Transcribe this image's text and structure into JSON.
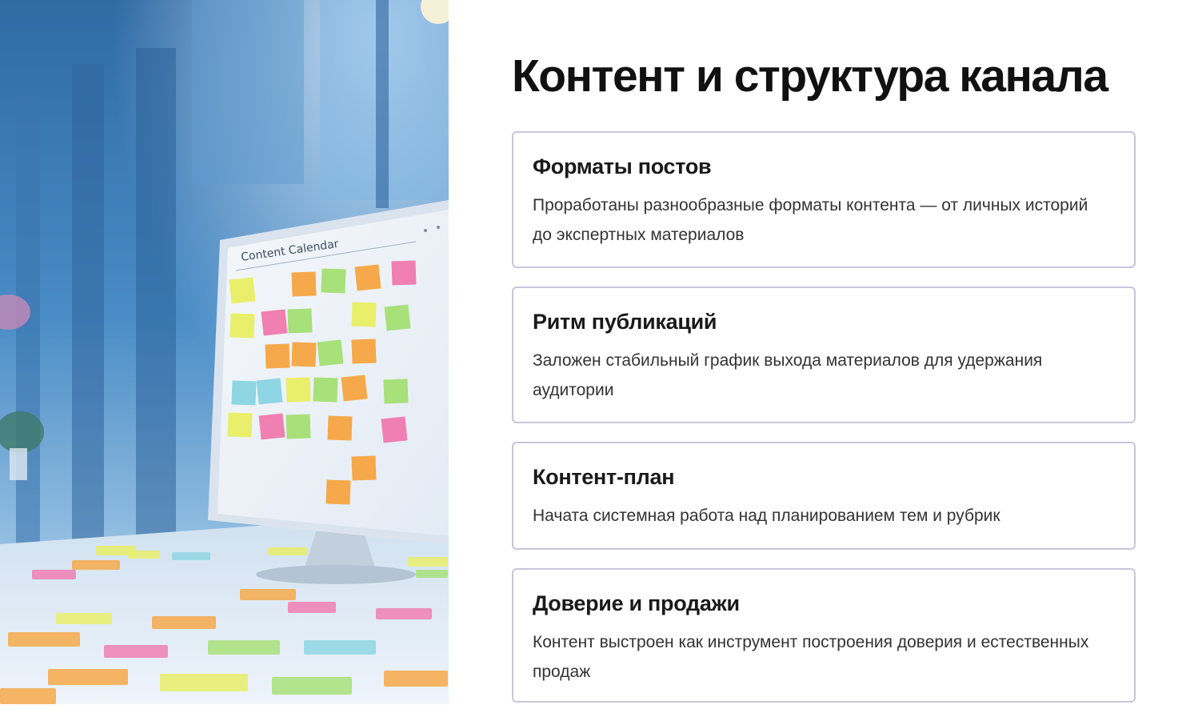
{
  "page": {
    "title": "Контент и структура канала"
  },
  "illustration": {
    "icon": "content-calendar-monitor-illustration",
    "monitor_label": "Content Calendar"
  },
  "cards": [
    {
      "title": "Форматы постов",
      "text": "Проработаны разнообразные форматы контента — от личных историй до экспертных материалов"
    },
    {
      "title": "Ритм публикаций",
      "text": "Заложен стабильный график выхода материалов для удержания аудитории"
    },
    {
      "title": "Контент-план",
      "text": "Начата системная работа над планированием тем и рубрик"
    },
    {
      "title": "Доверие и продажи",
      "text": "Контент выстроен как инструмент построения доверия и естественных продаж"
    }
  ],
  "colors": {
    "title": "#111111",
    "card_border": "#c9c6d9",
    "card_text": "#333333",
    "sticky_yellow": "#e9ef6a",
    "sticky_orange": "#f6a94a",
    "sticky_green": "#a8e07a",
    "sticky_pink": "#f07fb2",
    "sticky_cyan": "#8fd6e4"
  }
}
